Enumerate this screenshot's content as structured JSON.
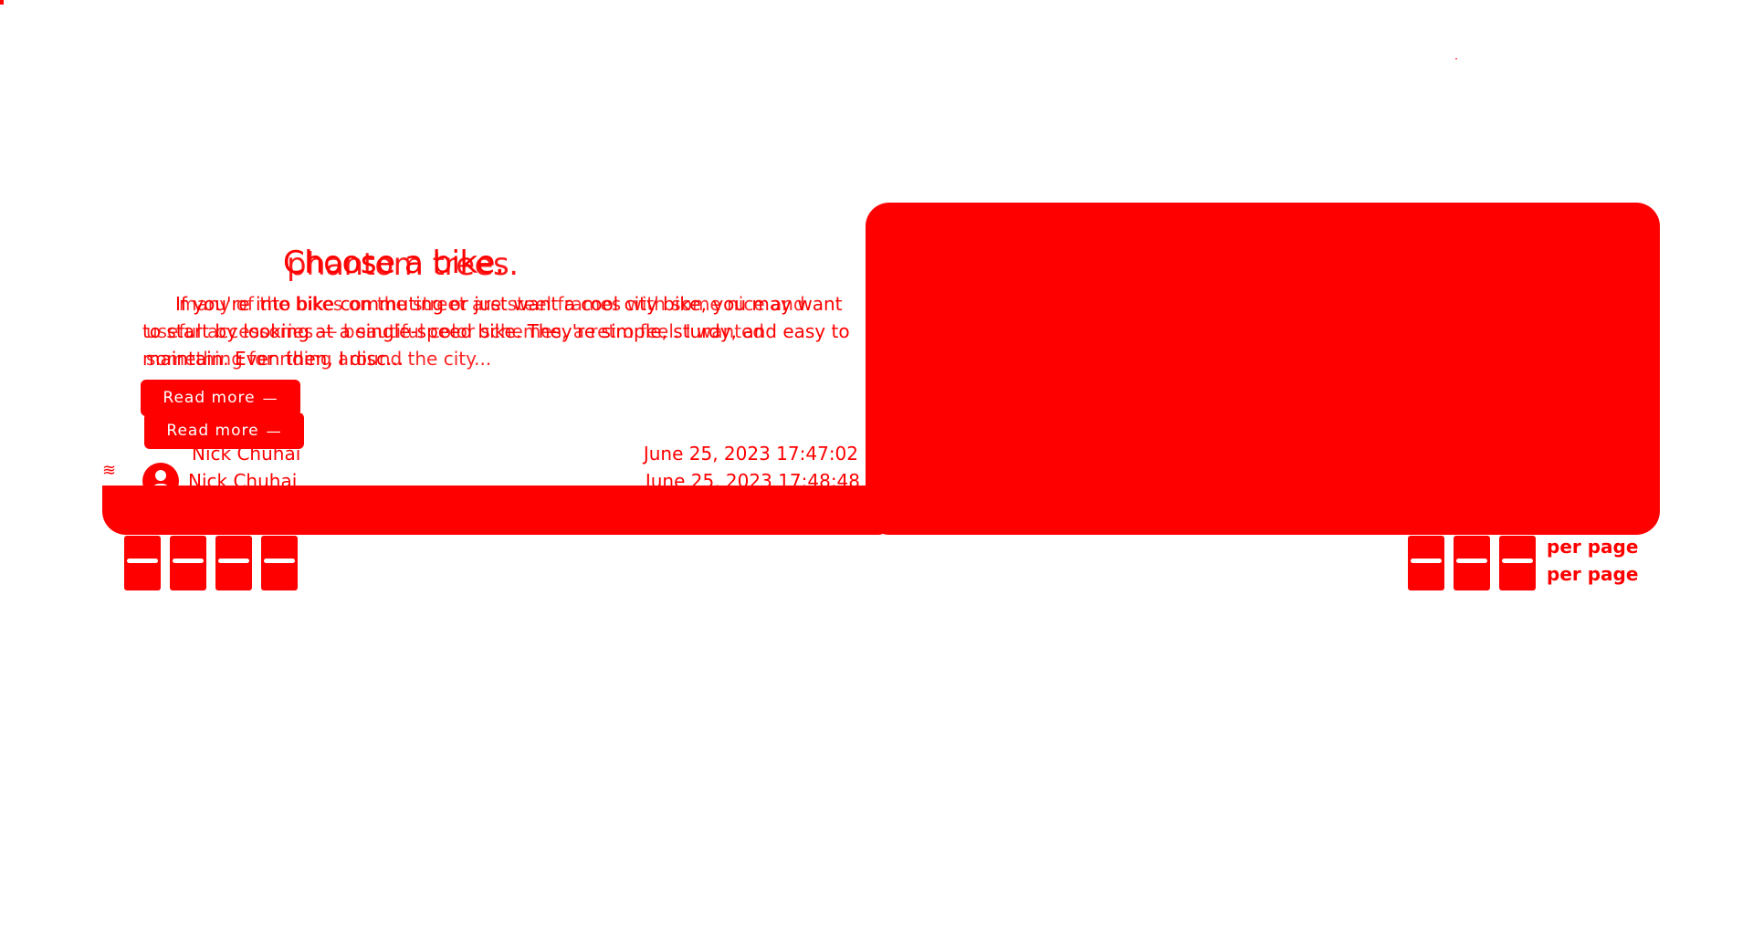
{
  "posts": [
    {
      "title": "Choose a bike.",
      "excerpt": "If you're into bike commuting or just want a cool city bike, you may want to start by looking at a single-speed bike. They're simple, sturdy, and easy to maintain. Even then, I disc...",
      "read_more": "Read more",
      "author": "Nick Chuhai",
      "date": "June 25, 2023 17:47:02"
    },
    {
      "title": "phantom trees.",
      "excerpt": "many of the bikes on the street are steel frames with some nice and useful accessories — beautiful color schemes, a retro feel. I wanted something for riding around the city...",
      "read_more": "Read more",
      "author": "Nick Chuhai",
      "date": "June 25, 2023 17:48:48"
    }
  ],
  "pagination": {
    "left_buttons": [
      "—",
      "—",
      "—",
      "—"
    ],
    "right_buttons": [
      "—",
      "—",
      "—"
    ],
    "per_page_labels": [
      "per page",
      "per page"
    ]
  },
  "colors": {
    "accent": "#ff0000",
    "background": "#ffffff"
  }
}
